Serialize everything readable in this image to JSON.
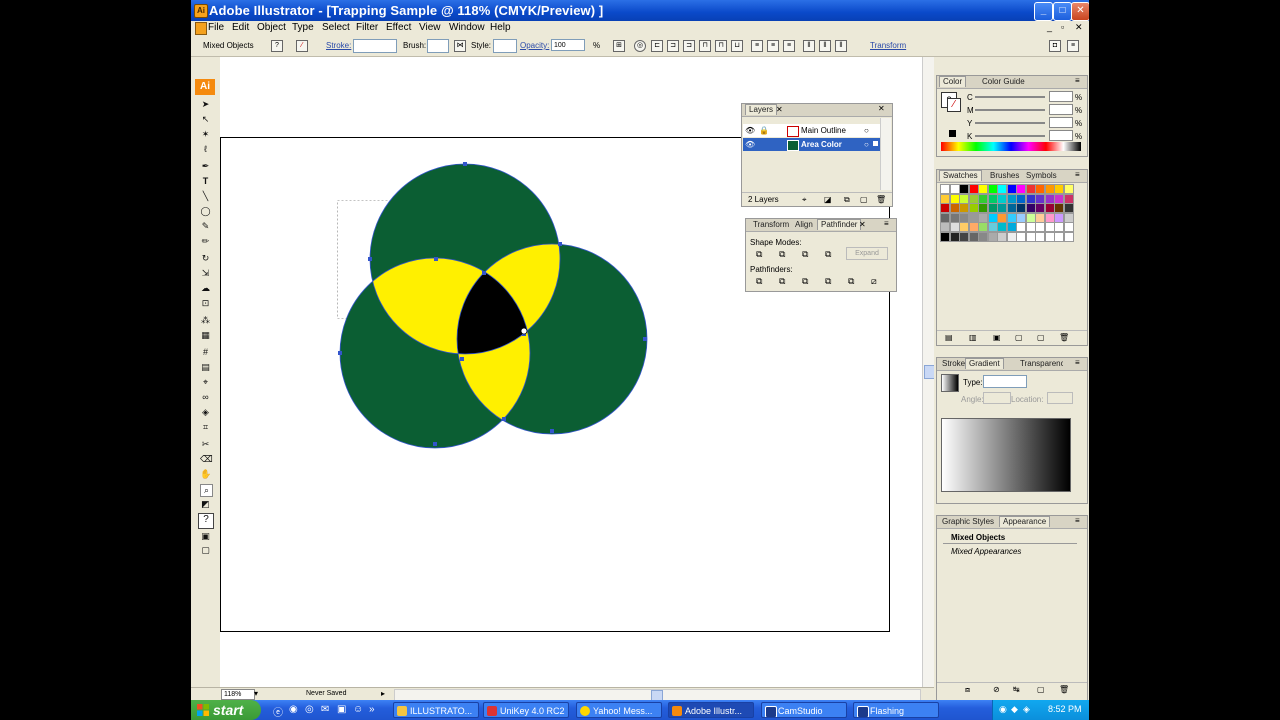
{
  "window": {
    "title": "Adobe Illustrator - [Trapping Sample @ 118% (CMYK/Preview) ]",
    "min": "_",
    "max": "□",
    "close": "✕"
  },
  "menu": {
    "items": [
      "File",
      "Edit",
      "Object",
      "Type",
      "Select",
      "Filter",
      "Effect",
      "View",
      "Window",
      "Help"
    ]
  },
  "control": {
    "selection_label": "Mixed Objects",
    "stroke_label": "Stroke:",
    "brush_label": "Brush:",
    "style_label": "Style:",
    "opacity_label": "Opacity:",
    "opacity_value": "100",
    "opacity_unit": "%",
    "transform_link": "Transform"
  },
  "toolbox": {
    "logo": "Ai"
  },
  "layers_panel": {
    "tab": "Layers",
    "rows": [
      {
        "name": "Main Outline"
      },
      {
        "name": "Area Color"
      }
    ],
    "count": "2 Layers"
  },
  "pathfinder_panel": {
    "tabs": [
      "Transform",
      "Align",
      "Pathfinder"
    ],
    "shape_modes": "Shape Modes:",
    "expand": "Expand",
    "pathfinders": "Pathfinders:"
  },
  "color_panel": {
    "tabs": [
      "Color",
      "Color Guide"
    ],
    "sliders": [
      "C",
      "M",
      "Y",
      "K"
    ],
    "unit": "%"
  },
  "swatches_panel": {
    "tabs": [
      "Swatches",
      "Brushes",
      "Symbols"
    ]
  },
  "gradient_panel": {
    "tabs": [
      "Stroke",
      "Gradient",
      "Transparency"
    ],
    "type_label": "Type:",
    "angle_label": "Angle:",
    "location_label": "Location:"
  },
  "appearance_panel": {
    "tabs": [
      "Graphic Styles",
      "Appearance"
    ],
    "title": "Mixed Objects",
    "subtitle": "Mixed Appearances"
  },
  "status": {
    "zoom": "118%",
    "saved": "Never Saved"
  },
  "taskbar": {
    "start": "start",
    "tasks": [
      "ILLUSTRATO...",
      "UniKey 4.0 RC2",
      "Yahoo! Mess...",
      "Adobe Illustr...",
      "CamStudio",
      "Flashing"
    ],
    "time": "8:52 PM"
  },
  "colors": {
    "green": "#0b5e33",
    "yellow": "#fff000",
    "black": "#000000",
    "selection": "#3355cc"
  }
}
